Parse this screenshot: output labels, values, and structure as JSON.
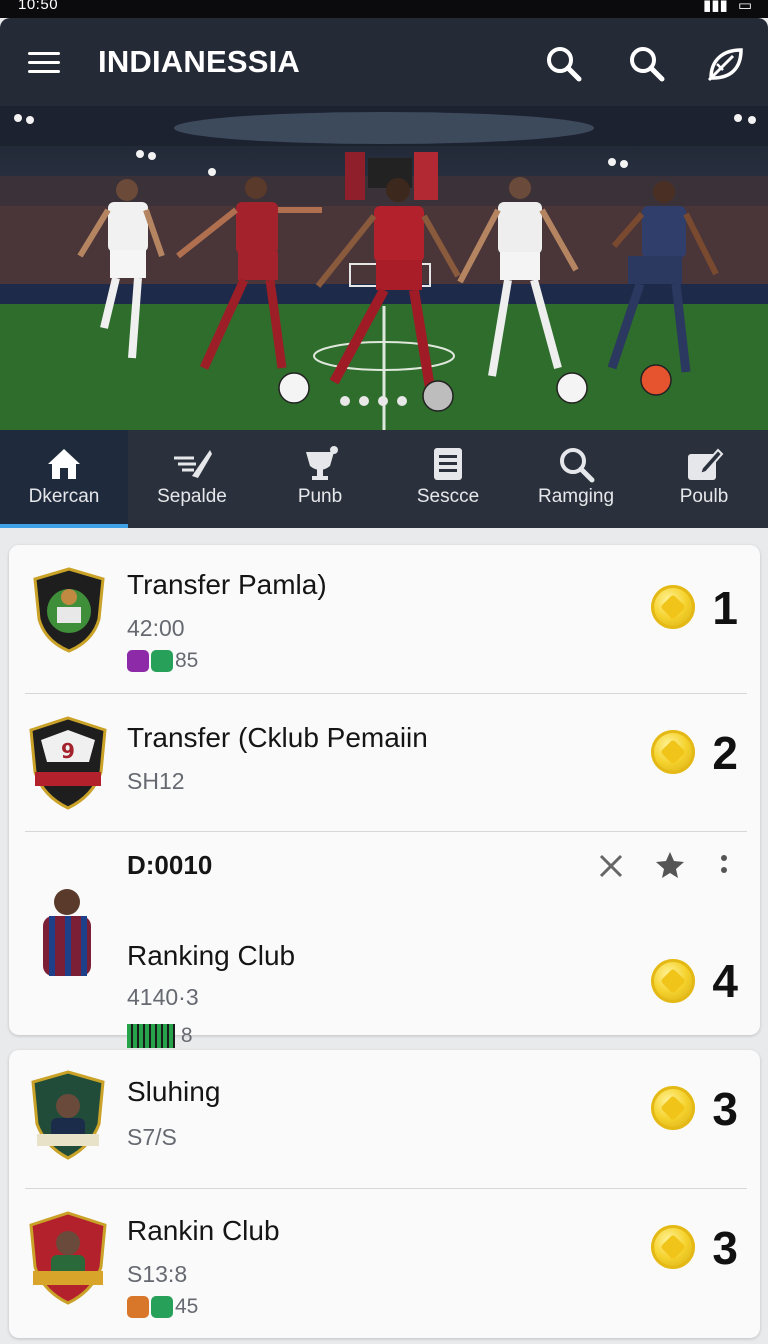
{
  "status_bar": {
    "time": "10:50"
  },
  "app_bar": {
    "title": "INDIANESSIA"
  },
  "hero": {
    "slides": 4
  },
  "tabs": [
    {
      "label": "Dkercan",
      "icon": "home-icon",
      "active": true
    },
    {
      "label": "Sepalde",
      "icon": "boot-icon",
      "active": false
    },
    {
      "label": "Punb",
      "icon": "trophy-icon",
      "active": false
    },
    {
      "label": "Sescce",
      "icon": "news-icon",
      "active": false
    },
    {
      "label": "Ramging",
      "icon": "search-icon",
      "active": false
    },
    {
      "label": "Poulb",
      "icon": "edit-icon",
      "active": false
    }
  ],
  "card1": {
    "rows": [
      {
        "title": "Transfer Pamla)",
        "sub": "42:00",
        "meta": "85",
        "rank": "1"
      },
      {
        "title": "Transfer (Cklub Pemaiin",
        "sub": "SH12",
        "rank": "2"
      },
      {
        "header": "D:0010",
        "title": "Ranking Club",
        "sub": "4140·3",
        "meta": "8",
        "rank": "4"
      }
    ]
  },
  "card2": {
    "rows": [
      {
        "title": "Sluhing",
        "sub": "S7/S",
        "rank": "3"
      },
      {
        "title": "Rankin Club",
        "sub": "S13:8",
        "meta": "45",
        "rank": "3"
      }
    ]
  },
  "colors": {
    "header_bg": "#252a37",
    "tab_active": "#3fa1e6",
    "coin": "#f5d22d"
  }
}
